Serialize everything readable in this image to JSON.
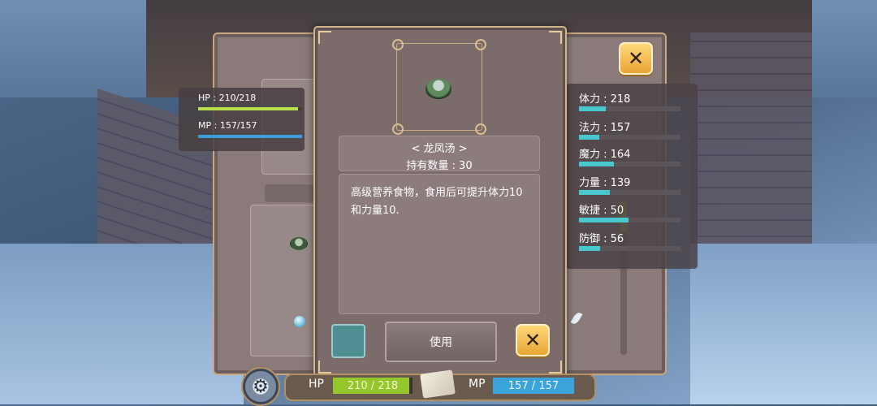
{
  "character": {
    "hp_label": "HP : 210/218",
    "hp_fraction": 0.963,
    "mp_label": "MP : 157/157",
    "mp_fraction": 1.0
  },
  "attributes": [
    {
      "label": "体力 : 218",
      "fill": 0.26
    },
    {
      "label": "法力 : 157",
      "fill": 0.2
    },
    {
      "label": "魔力 : 164",
      "fill": 0.34
    },
    {
      "label": "力量 : 139",
      "fill": 0.3
    },
    {
      "label": "敏捷 : 50",
      "fill": 0.49
    },
    {
      "label": "防御 : 56",
      "fill": 0.21
    }
  ],
  "item_detail": {
    "icon": "soup-bowl-icon",
    "name": "< 龙凤汤 >",
    "quantity": "持有数量 : 30",
    "description": "高级营养食物，食用后可提升体力10和力量10.",
    "use_label": "使用"
  },
  "hud": {
    "hp_label": "HP",
    "hp_value": "210 / 218",
    "hp_fraction": 0.963,
    "mp_label": "MP",
    "mp_value": "157 / 157",
    "mp_fraction": 1.0
  },
  "icons": {
    "close": "close-icon",
    "settings": "gear-icon"
  },
  "colors": {
    "hp": "#94c72b",
    "mp": "#3aa3d9",
    "attribute_bar": "#48c8cf",
    "close_button": "#e9a534"
  }
}
